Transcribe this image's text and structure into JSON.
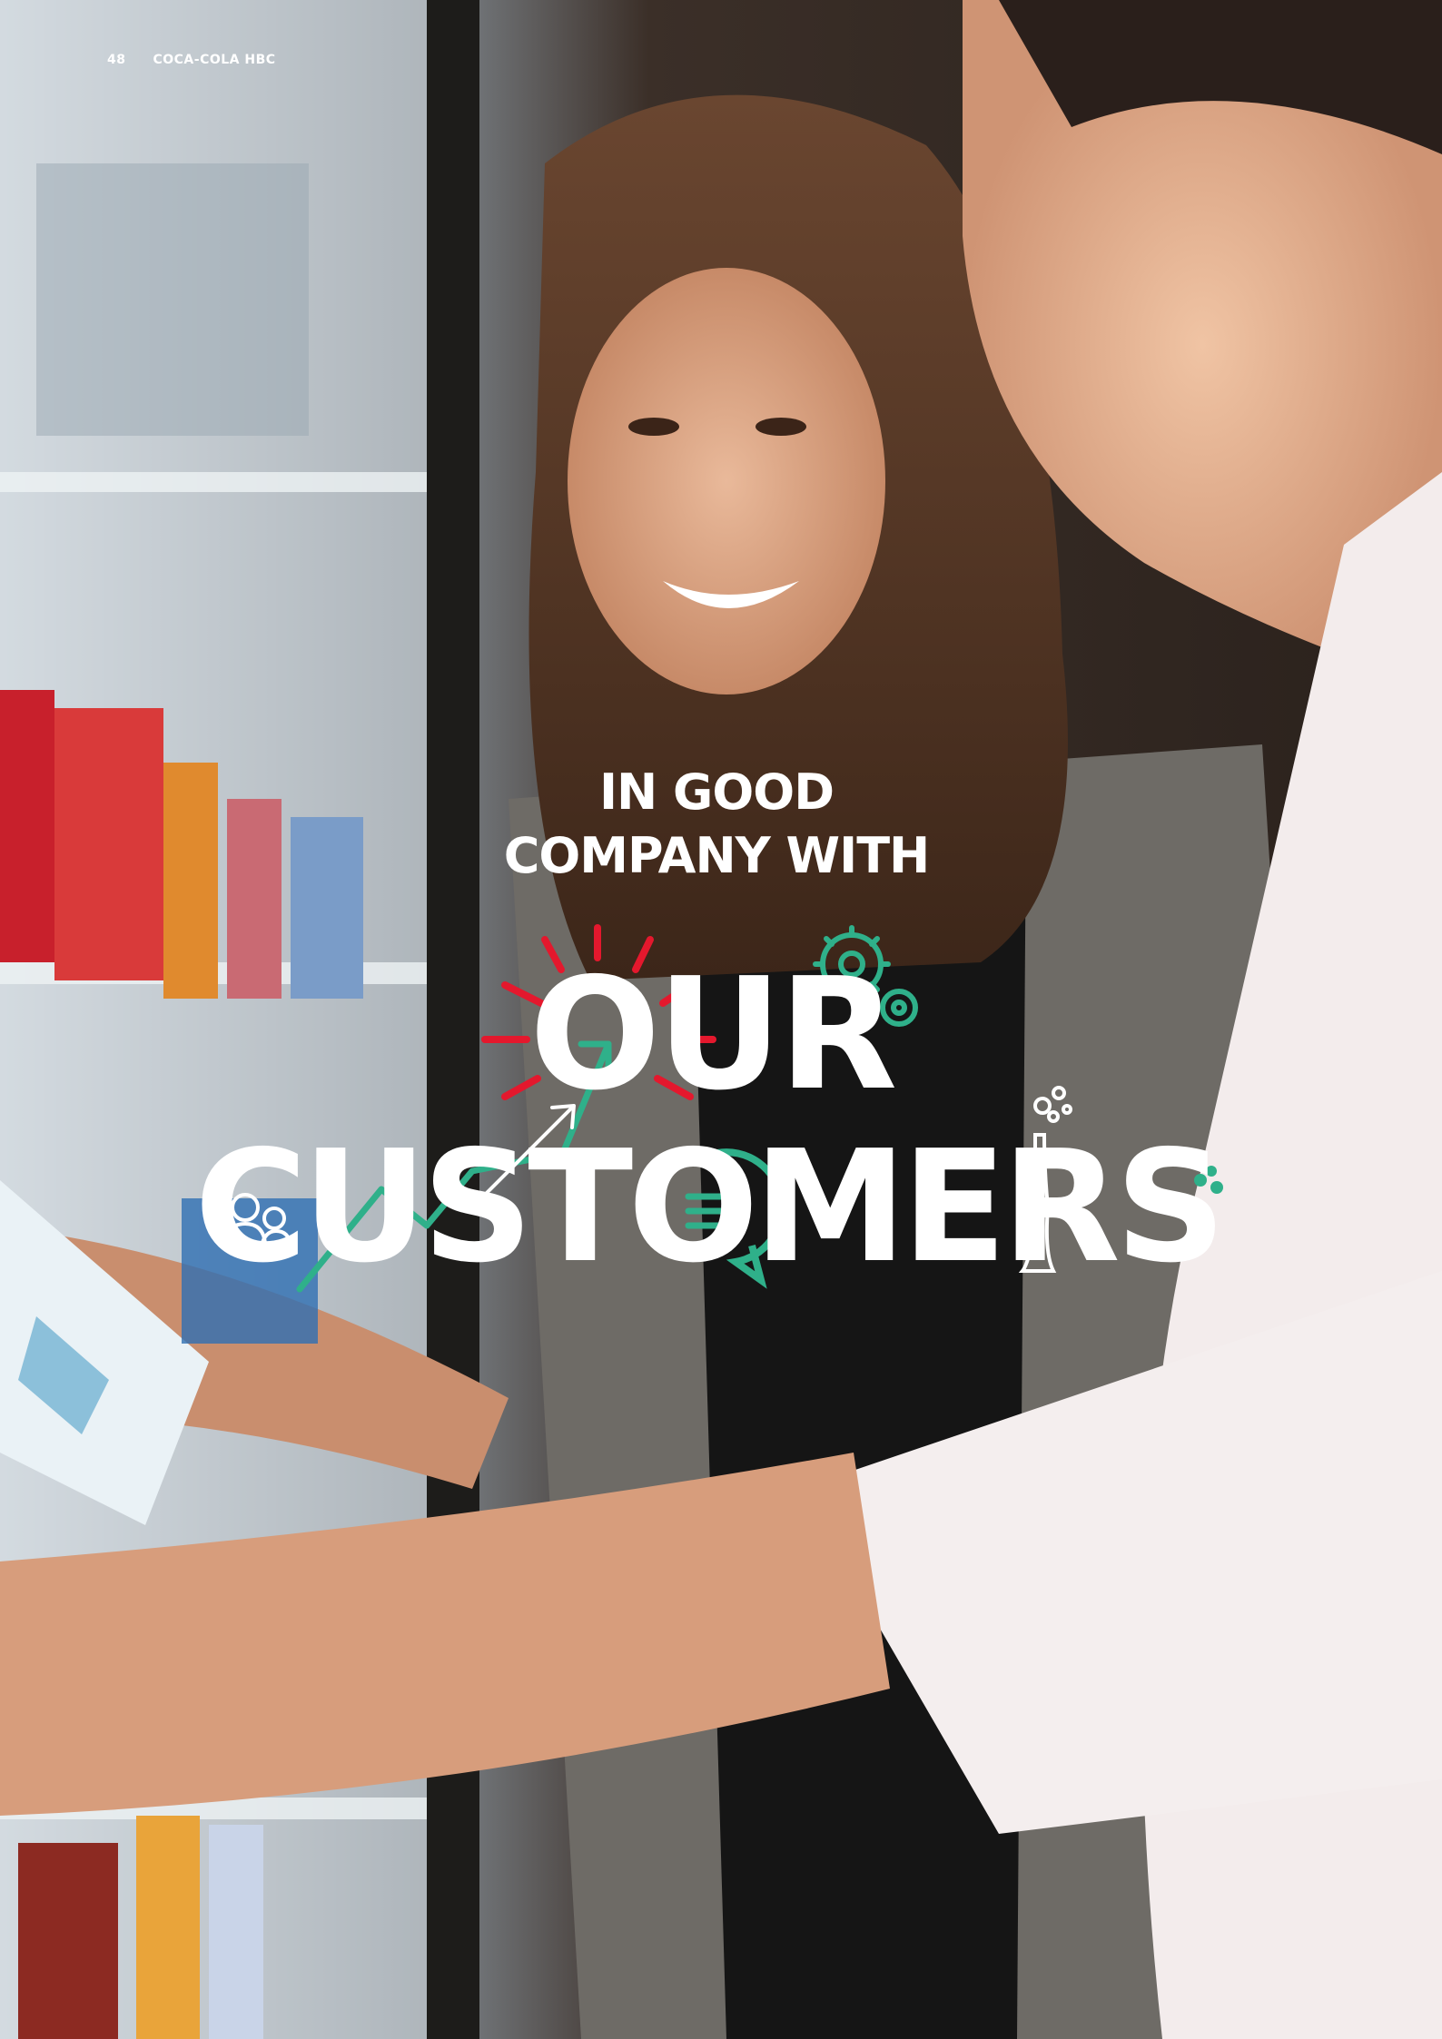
{
  "folio": {
    "page_number": "48",
    "publication": "COCA-COLA HBC"
  },
  "headline": {
    "line1": "IN GOOD",
    "line2": "COMPANY WITH",
    "word1": "OUR",
    "word2": "CUSTOMERS"
  },
  "colors": {
    "accent_red": "#e4182d",
    "accent_green": "#2fb08a",
    "text": "#ffffff"
  },
  "icons": [
    "burst-icon",
    "gears-icon",
    "growth-arrow-icon",
    "people-icon",
    "chat-bubble-icon",
    "bottle-icon",
    "dots-icon"
  ]
}
